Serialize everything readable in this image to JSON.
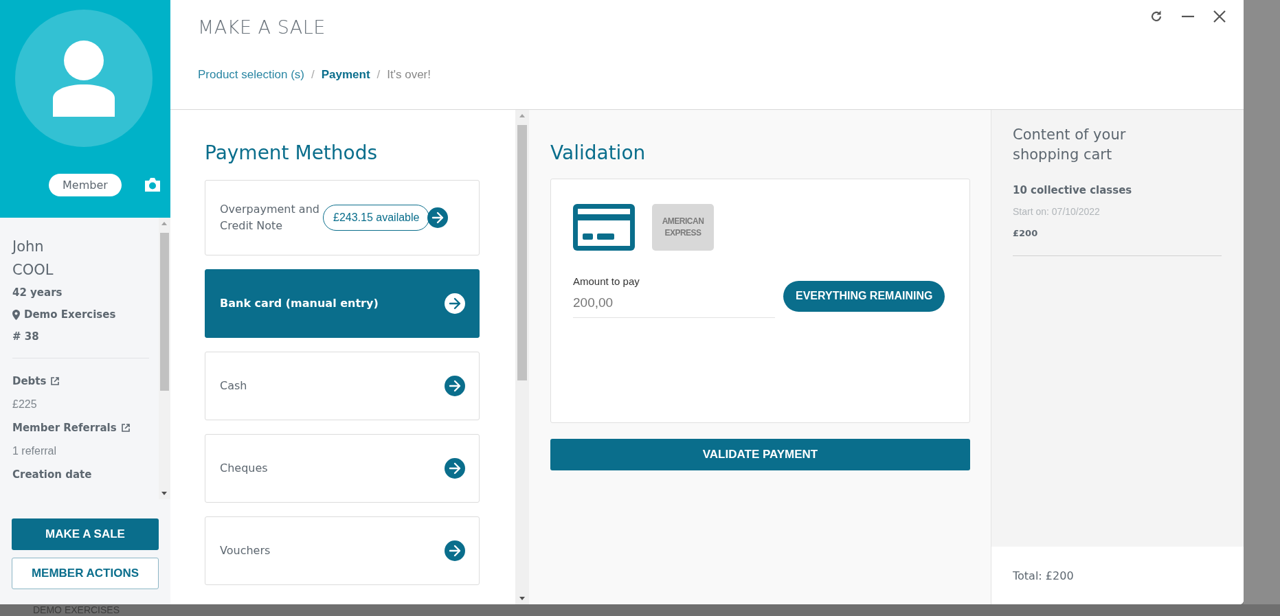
{
  "sidebar": {
    "badge": "Member",
    "first_name": "John",
    "last_name": "COOL",
    "age": "42 years",
    "location": "Demo Exercises",
    "number": "# 38",
    "fields": [
      {
        "label": "Debts",
        "link": true,
        "value": "£225"
      },
      {
        "label": "Member Referrals",
        "link": true,
        "value": "1 referral"
      },
      {
        "label": "Creation date",
        "link": false
      }
    ],
    "buttons": [
      {
        "label": "MAKE A SALE",
        "kind": "primary"
      },
      {
        "label": "MEMBER ACTIONS",
        "kind": "outline"
      }
    ]
  },
  "modal": {
    "title": "MAKE A SALE",
    "separator": "/",
    "breadcrumb": [
      {
        "label": "Product selection (s)",
        "kind": "done"
      },
      {
        "label": "Payment",
        "kind": "current"
      },
      {
        "label": "It's over!",
        "kind": "upcoming"
      }
    ],
    "payment_methods": {
      "title": "Payment Methods",
      "items": [
        {
          "label": "Overpayment and Credit Note",
          "badge": "£243.15 available",
          "selected": false
        },
        {
          "label": "Bank card (manual entry)",
          "selected": true
        },
        {
          "label": "Cash",
          "selected": false
        },
        {
          "label": "Cheques",
          "selected": false
        },
        {
          "label": "Vouchers",
          "selected": false
        }
      ]
    },
    "validation": {
      "title": "Validation",
      "card_types": [
        {
          "kind": "generic",
          "selected": true
        },
        {
          "kind": "amex",
          "lines": [
            "AMERICAN",
            "EXPRESS"
          ],
          "selected": false
        }
      ],
      "amount": {
        "label": "Amount to pay",
        "value": "200,00"
      },
      "fill_button": "EVERYTHING REMAINING",
      "validate_button": "VALIDATE PAYMENT"
    },
    "cart": {
      "title": "Content of your shopping cart",
      "items": [
        {
          "name": "10 collective classes",
          "start": "Start on: 07/10/2022",
          "price": "£200"
        }
      ],
      "total": "Total: £200"
    }
  },
  "background": {
    "text": "DEMO EXERCISES"
  }
}
